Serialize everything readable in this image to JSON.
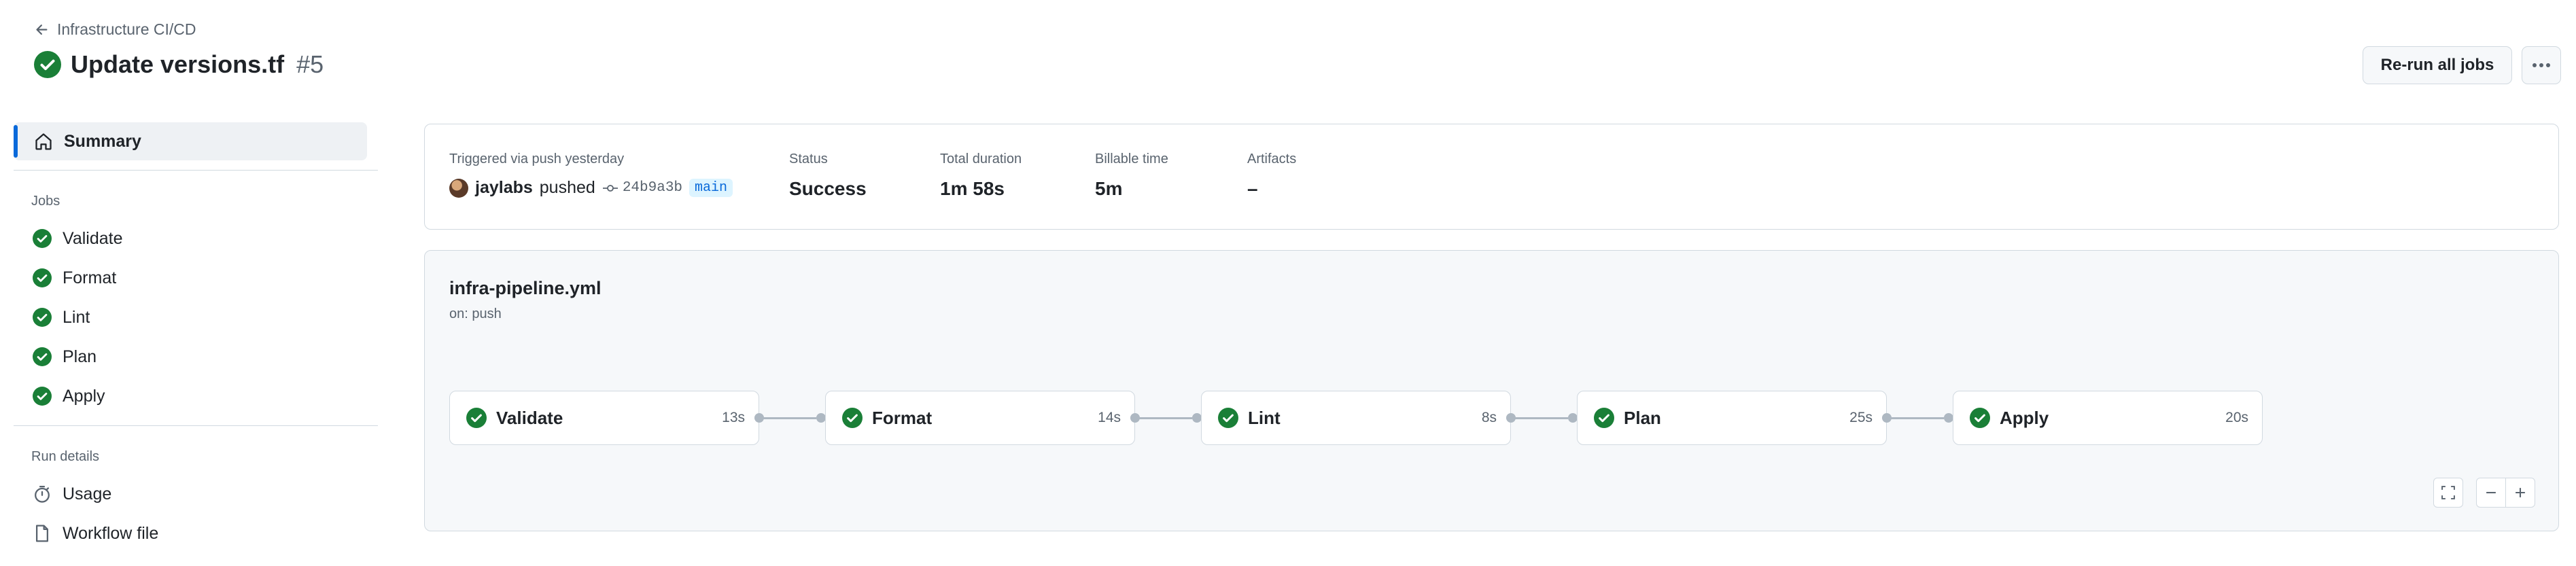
{
  "header": {
    "back_label": "Infrastructure CI/CD",
    "title": "Update versions.tf",
    "run_number": "#5",
    "rerun_label": "Re-run all jobs",
    "more_label": "···"
  },
  "sidebar": {
    "summary_label": "Summary",
    "jobs_heading": "Jobs",
    "jobs": [
      {
        "label": "Validate"
      },
      {
        "label": "Format"
      },
      {
        "label": "Lint"
      },
      {
        "label": "Plan"
      },
      {
        "label": "Apply"
      }
    ],
    "run_details_heading": "Run details",
    "usage_label": "Usage",
    "workflow_file_label": "Workflow file"
  },
  "summary": {
    "trigger_label": "Triggered via push yesterday",
    "actor": "jaylabs",
    "action": "pushed",
    "sha": "24b9a3b",
    "branch": "main",
    "status_label": "Status",
    "status_value": "Success",
    "duration_label": "Total duration",
    "duration_value": "1m 58s",
    "billable_label": "Billable time",
    "billable_value": "5m",
    "artifacts_label": "Artifacts",
    "artifacts_value": "–"
  },
  "graph": {
    "workflow_name": "infra-pipeline.yml",
    "trigger": "on: push",
    "jobs": [
      {
        "name": "Validate",
        "time": "13s"
      },
      {
        "name": "Format",
        "time": "14s"
      },
      {
        "name": "Lint",
        "time": "8s"
      },
      {
        "name": "Plan",
        "time": "25s"
      },
      {
        "name": "Apply",
        "time": "20s"
      }
    ]
  },
  "colors": {
    "success": "#1a7f37",
    "accent": "#0969da"
  },
  "icons": {
    "back": "arrow-left-icon",
    "status": "check-circle-fill-icon",
    "summary": "home-icon",
    "usage": "stopwatch-icon",
    "workflow_file": "file-icon",
    "commit": "git-commit-icon",
    "fullscreen": "screen-full-icon",
    "zoom_out": "dash-icon",
    "zoom_in": "plus-icon"
  }
}
